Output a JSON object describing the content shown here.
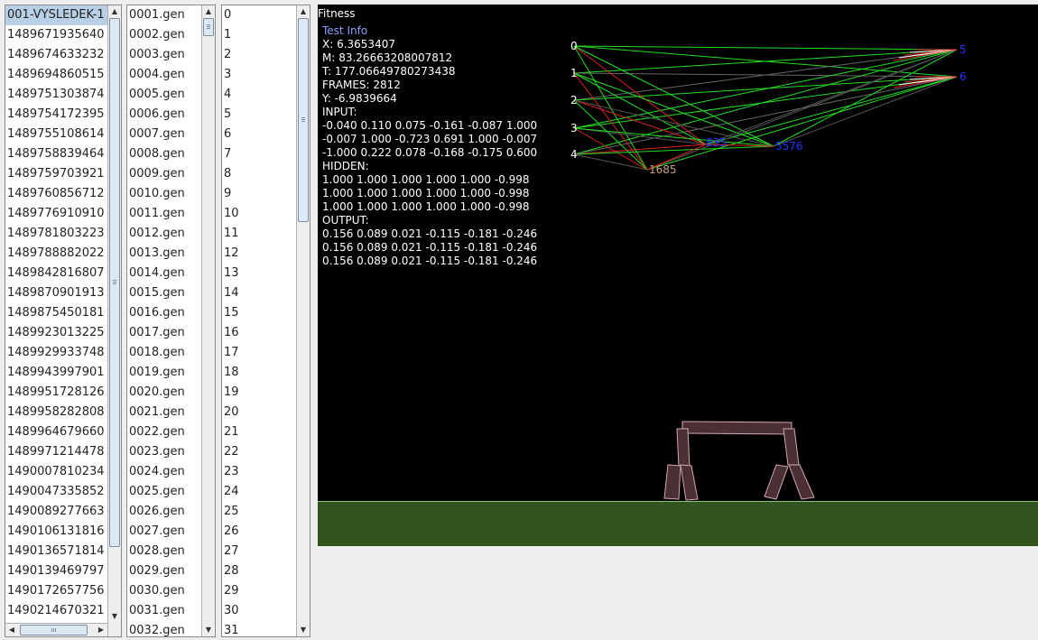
{
  "list_results": {
    "items": [
      "001-VYSLEDEK-1",
      "1489671935640",
      "1489674633232",
      "1489694860515",
      "1489751303874",
      "1489754172395",
      "1489755108614",
      "1489758839464",
      "1489759703921",
      "1489760856712",
      "1489776910910",
      "1489781803223",
      "1489788882022",
      "1489842816807",
      "1489870901913",
      "1489875450181",
      "1489923013225",
      "1489929933748",
      "1489943997901",
      "1489951728126",
      "1489958282808",
      "1489964679660",
      "1489971214478",
      "1490007810234",
      "1490047335852",
      "1490089277663",
      "1490106131816",
      "1490136571814",
      "1490139469797",
      "1490172657756",
      "1490214670321"
    ]
  },
  "list_generations": {
    "items": [
      "0001.gen",
      "0002.gen",
      "0003.gen",
      "0004.gen",
      "0005.gen",
      "0006.gen",
      "0007.gen",
      "0008.gen",
      "0009.gen",
      "0010.gen",
      "0011.gen",
      "0012.gen",
      "0013.gen",
      "0014.gen",
      "0015.gen",
      "0016.gen",
      "0017.gen",
      "0018.gen",
      "0019.gen",
      "0020.gen",
      "0021.gen",
      "0022.gen",
      "0023.gen",
      "0024.gen",
      "0025.gen",
      "0026.gen",
      "0027.gen",
      "0028.gen",
      "0029.gen",
      "0030.gen",
      "0031.gen",
      "0032.gen"
    ]
  },
  "list_individuals": {
    "items": [
      "0",
      "1",
      "2",
      "3",
      "4",
      "5",
      "6",
      "7",
      "8",
      "9",
      "10",
      "11",
      "12",
      "13",
      "14",
      "15",
      "16",
      "17",
      "18",
      "19",
      "20",
      "21",
      "22",
      "23",
      "24",
      "25",
      "26",
      "27",
      "28",
      "29",
      "30",
      "31"
    ]
  },
  "scene": {
    "fitness_label": "Fitness",
    "test_info_label": "Test Info",
    "x": "X: 6.3653407",
    "m": "M: 83.26663208007812",
    "t": "T: 177.06649780273438",
    "frames": "FRAMES: 2812",
    "y": "Y: -6.9839664",
    "input_label": "INPUT:",
    "input_rows": [
      "-0.040 0.110 0.075 -0.161 -0.087 1.000",
      "-0.007 1.000 -0.723 0.691 1.000 -0.007",
      "-1.000 0.222 0.078 -0.168 -0.175 0.600"
    ],
    "hidden_label": "HIDDEN:",
    "hidden_rows": [
      "1.000 1.000 1.000 1.000 1.000 -0.998",
      "1.000 1.000 1.000 1.000 1.000 -0.998",
      "1.000 1.000 1.000 1.000 1.000 -0.998"
    ],
    "output_label": "OUTPUT:",
    "output_rows": [
      "0.156 0.089 0.021 -0.115 -0.181 -0.246",
      "0.156 0.089 0.021 -0.115 -0.181 -0.246",
      "0.156 0.089 0.021 -0.115 -0.181 -0.246"
    ],
    "network": {
      "input_nodes": [
        "0",
        "1",
        "2",
        "3",
        "4"
      ],
      "output_nodes": [
        "5",
        "6"
      ],
      "hidden_nodes": [
        "835",
        "5576",
        "1685"
      ]
    },
    "colors": {
      "background": "#000000",
      "ground": "#32551f",
      "link_positive": "#22dd22",
      "link_negative": "#dd2222",
      "output_label": "#2233ff",
      "hidden_label_a": "#2233ff",
      "hidden_label_b": "#c8a27a"
    }
  }
}
